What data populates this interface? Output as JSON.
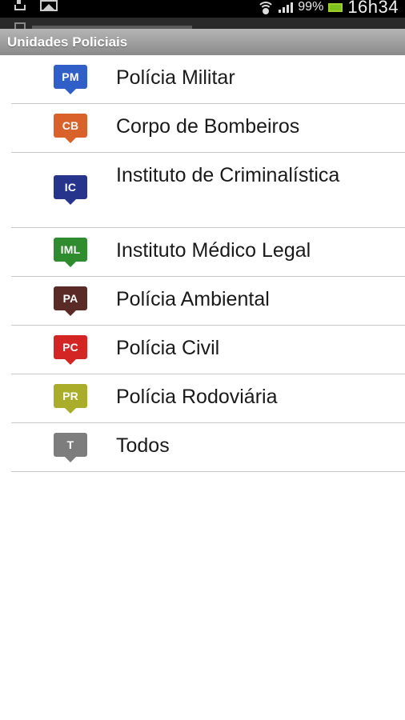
{
  "status_bar": {
    "battery": "99%",
    "time": "16h34"
  },
  "header": {
    "title": "Unidades Policiais"
  },
  "units": [
    {
      "badge": "PM",
      "label": "Polícia Militar",
      "color": "#2f5fc7"
    },
    {
      "badge": "CB",
      "label": "Corpo de Bombeiros",
      "color": "#d9622b"
    },
    {
      "badge": "IC",
      "label": "Instituto de Criminalística",
      "color": "#27348b"
    },
    {
      "badge": "IML",
      "label": "Instituto Médico Legal",
      "color": "#2e8b2e"
    },
    {
      "badge": "PA",
      "label": "Polícia Ambiental",
      "color": "#5a2a27"
    },
    {
      "badge": "PC",
      "label": "Polícia Civil",
      "color": "#d42525"
    },
    {
      "badge": "PR",
      "label": "Polícia Rodoviária",
      "color": "#a9ad2a"
    },
    {
      "badge": "T",
      "label": "Todos",
      "color": "#7d7d7d"
    }
  ]
}
